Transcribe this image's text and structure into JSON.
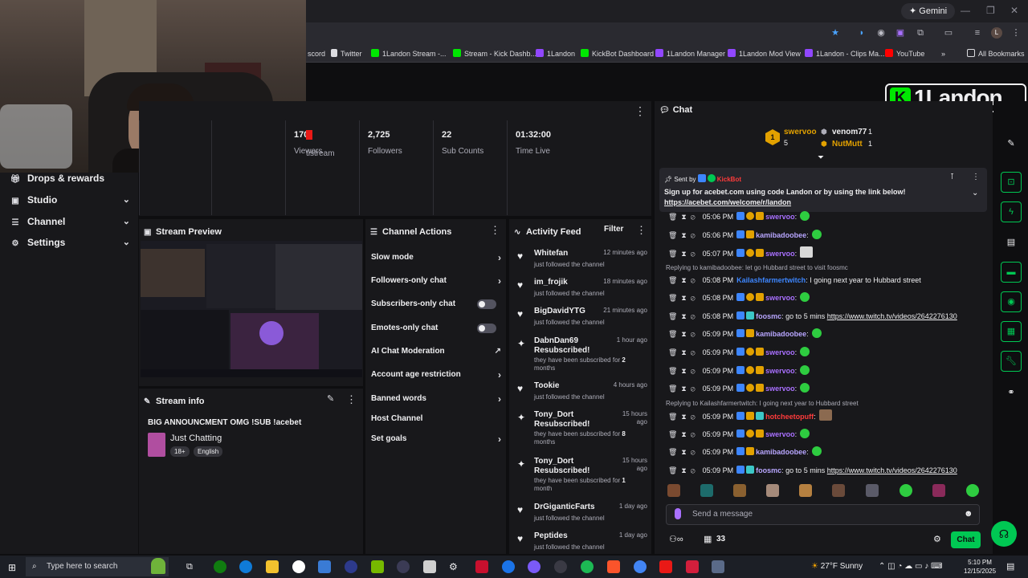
{
  "browser": {
    "gemini_label": "Gemini",
    "bookmarks": [
      {
        "label": "scord"
      },
      {
        "label": "Twitter"
      },
      {
        "label": "1Landon Stream -..."
      },
      {
        "label": "Stream - Kick Dashb..."
      },
      {
        "label": "1Landon"
      },
      {
        "label": "KickBot Dashboard"
      },
      {
        "label": "1Landon Manager"
      },
      {
        "label": "1Landon Mod View"
      },
      {
        "label": "1Landon - Clips Ma..."
      },
      {
        "label": "YouTube"
      }
    ],
    "all_bookmarks": "All Bookmarks"
  },
  "sidebar": {
    "items": [
      {
        "label": "Drops & rewards",
        "icon": "gift-icon"
      },
      {
        "label": "Studio",
        "icon": "video-icon"
      },
      {
        "label": "Channel",
        "icon": "sliders-icon"
      },
      {
        "label": "Settings",
        "icon": "gear-icon"
      }
    ]
  },
  "stats": {
    "first_label": "tistream",
    "items": [
      {
        "value": "170",
        "label": "Viewers"
      },
      {
        "value": "2,725",
        "label": "Followers"
      },
      {
        "value": "22",
        "label": "Sub Counts"
      },
      {
        "value": "01:32:00",
        "label": "Time Live"
      }
    ]
  },
  "stream_preview": {
    "title": "Stream Preview"
  },
  "stream_info": {
    "title": "Stream info",
    "stream_title": "BIG ANNOUNCMENT OMG !SUB !acebet",
    "category": "Just Chatting",
    "tags": [
      "18+",
      "English"
    ]
  },
  "channel_actions": {
    "title": "Channel Actions",
    "items": [
      {
        "label": "Slow mode"
      },
      {
        "label": "Followers-only chat"
      },
      {
        "label": "Subscribers-only chat"
      },
      {
        "label": "Emotes-only chat"
      },
      {
        "label": "AI Chat Moderation"
      },
      {
        "label": "Account age restriction"
      },
      {
        "label": "Banned words"
      },
      {
        "label": "Host Channel"
      },
      {
        "label": "Set goals"
      }
    ]
  },
  "activity_feed": {
    "title": "Activity Feed",
    "filter": "Filter",
    "items": [
      {
        "name": "Whitefan",
        "time": "12 minutes ago",
        "desc": "just followed the channel",
        "icon": "heart-icon"
      },
      {
        "name": "im_frojik",
        "time": "18 minutes ago",
        "desc": "just followed the channel",
        "icon": "heart-icon"
      },
      {
        "name": "BigDavidYTG",
        "time": "21 minutes ago",
        "desc": "just followed the channel",
        "icon": "heart-icon"
      },
      {
        "name": "DabnDan69 Resubscribed!",
        "time": "1 hour ago",
        "desc": "they have been subscribed for",
        "months": "2",
        "months_unit": "months",
        "icon": "star-icon"
      },
      {
        "name": "Tookie",
        "time": "4 hours ago",
        "desc": "just followed the channel",
        "icon": "heart-icon"
      },
      {
        "name": "Tony_Dort Resubscribed!",
        "time": "15 hours ago",
        "desc": "they have been subscribed for",
        "months": "8",
        "months_unit": "months",
        "icon": "star-icon"
      },
      {
        "name": "Tony_Dort Resubscribed!",
        "time": "15 hours ago",
        "desc": "they have been subscribed for",
        "months": "1",
        "months_unit": "month",
        "icon": "star-icon"
      },
      {
        "name": "DrGiganticFarts",
        "time": "1 day ago",
        "desc": "just followed the channel",
        "icon": "heart-icon"
      },
      {
        "name": "Peptides",
        "time": "1 day ago",
        "desc": "just followed the channel",
        "icon": "heart-icon"
      }
    ]
  },
  "chat": {
    "title": "Chat",
    "leaders": [
      {
        "name": "swervoo",
        "count": "5",
        "rank": "1"
      },
      {
        "name": "venom77",
        "count": "1"
      },
      {
        "name": "NutMutt",
        "count": "1"
      }
    ],
    "pinned": {
      "sent_by": "Sent by",
      "bot": "KickBot",
      "text": "Sign up for acebet.com using code Landon or by using the link below!",
      "link": "https://acebet.com/welcome/r/landon"
    },
    "messages": [
      {
        "time": "05:06 PM",
        "user": "swervoo",
        "color": "#a970ff",
        "text": ":",
        "link": ""
      },
      {
        "time": "05:06 PM",
        "user": "kamibadoobee",
        "color": "#b8a6ff",
        "text": ":",
        "link": ""
      },
      {
        "time": "05:07 PM",
        "user": "swervoo",
        "color": "#a970ff",
        "text": ":",
        "link": ""
      },
      {
        "time": "05:08 PM",
        "user": "Kailashfarmertwitch",
        "color": "#3d86ff",
        "text": ": I going next year to Hubbard street",
        "link": ""
      },
      {
        "time": "05:08 PM",
        "user": "swervoo",
        "color": "#a970ff",
        "text": ":",
        "link": ""
      },
      {
        "time": "05:08 PM",
        "user": "foosmc",
        "color": "#b8a6ff",
        "text": ": go to 5 mins ",
        "link": "https://www.twitch.tv/videos/2642276130"
      },
      {
        "time": "05:09 PM",
        "user": "kamibadoobee",
        "color": "#b8a6ff",
        "text": ":",
        "link": ""
      },
      {
        "time": "05:09 PM",
        "user": "swervoo",
        "color": "#a970ff",
        "text": ":",
        "link": ""
      },
      {
        "time": "05:09 PM",
        "user": "swervoo",
        "color": "#a970ff",
        "text": ":",
        "link": ""
      },
      {
        "time": "05:09 PM",
        "user": "swervoo",
        "color": "#a970ff",
        "text": ":",
        "link": ""
      },
      {
        "time": "05:09 PM",
        "user": "hotcheetopuff",
        "color": "#ff3b3b",
        "text": ":",
        "link": ""
      },
      {
        "time": "05:09 PM",
        "user": "swervoo",
        "color": "#a970ff",
        "text": ":",
        "link": ""
      },
      {
        "time": "05:09 PM",
        "user": "kamibadoobee",
        "color": "#b8a6ff",
        "text": ":",
        "link": ""
      },
      {
        "time": "05:09 PM",
        "user": "foosmc",
        "color": "#b8a6ff",
        "text": ": go to 5 mins ",
        "link": "https://www.twitch.tv/videos/2642276130"
      }
    ],
    "reply_hints": [
      "Replying to kamibadoobee: let go Hubbard street to visit foosmc",
      "Replying to Kailashfarmertwitch: I going next year to Hubbard street"
    ],
    "input_placeholder": "Send a message",
    "viewer_count": "33",
    "send_label": "Chat"
  },
  "logo": {
    "text": "1Landon",
    "k": "K"
  },
  "taskbar": {
    "search_placeholder": "Type here to search",
    "weather": "27°F  Sunny",
    "time": "5:10 PM",
    "date": "12/15/2025"
  },
  "colors": {
    "accent": "#00c853",
    "kick_green": "#00e701",
    "panel": "#18181b",
    "bg": "#0e0e10"
  }
}
